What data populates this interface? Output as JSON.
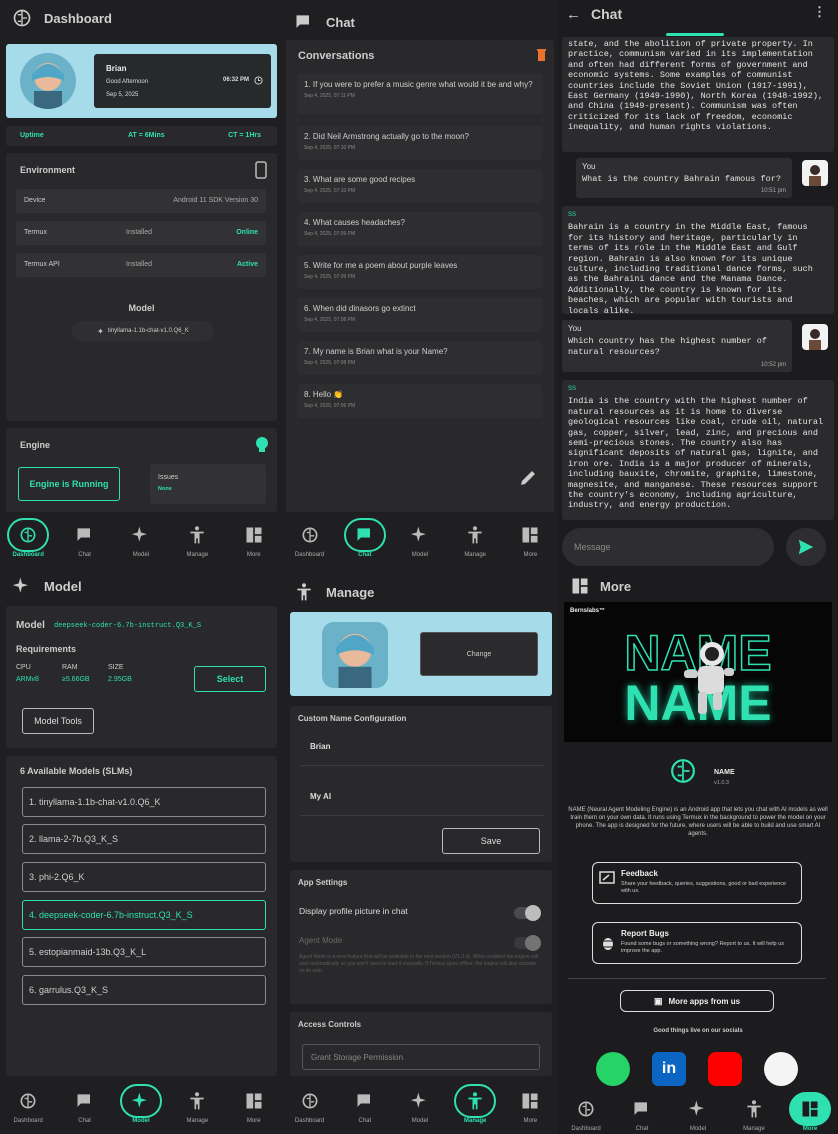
{
  "dashboard": {
    "title": "Dashboard",
    "user": "Brian",
    "greeting": "Good Afternoon",
    "time": "06:32 PM",
    "date": "Sep 5, 2025",
    "uptime_label": "Uptime",
    "at": "AT = 6Mins",
    "ct": "CT = 1Hrs",
    "env_title": "Environment",
    "rows": [
      {
        "label": "Device",
        "value": "Android 11 SDK Version 30",
        "status": ""
      },
      {
        "label": "Termux",
        "value": "Installed",
        "status": "Online"
      },
      {
        "label": "Termux API",
        "value": "Installed",
        "status": "Active"
      }
    ],
    "model_title": "Model",
    "model_name": "tinyllama-1.1b-chat-v1.0.Q6_K",
    "engine_title": "Engine",
    "engine_btn": "Engine is Running",
    "issues_label": "Issues",
    "issues_value": "None"
  },
  "nav": {
    "dashboard": "Dashboard",
    "chat": "Chat",
    "model": "Model",
    "manage": "Manage",
    "more": "More"
  },
  "chatlist": {
    "title": "Chat",
    "section": "Conversations",
    "items": [
      {
        "q": "1. If you were to prefer a music genre what would it be and why?",
        "d": "Sep 4, 2025, 07:11 PM"
      },
      {
        "q": "2. Did Neil Armstrong actually go to the moon?",
        "d": "Sep 4, 2025, 07:10 PM"
      },
      {
        "q": "3. What are some good recipes",
        "d": "Sep 4, 2025, 07:10 PM"
      },
      {
        "q": "4. What causes headaches?",
        "d": "Sep 4, 2025, 07:09 PM"
      },
      {
        "q": "5. Write for me a poem about purple leaves",
        "d": "Sep 4, 2025, 07:09 PM"
      },
      {
        "q": "6. When did dinasors go extinct",
        "d": "Sep 4, 2025, 07:08 PM"
      },
      {
        "q": "7. My name is Brian what is your Name?",
        "d": "Sep 4, 2025, 07:08 PM"
      },
      {
        "q": "8. Hello 👏",
        "d": "Sep 4, 2025, 07:06 PM"
      }
    ]
  },
  "chat": {
    "title": "Chat",
    "ai1": "state, and the abolition of private property. In practice, communism varied in its implementation and often had different forms of government and economic systems. Some examples of communist countries include the Soviet Union (1917-1991), East Germany (1949-1990), North Korea (1948-1992), and China (1949-present). Communism was often criticized for its lack of freedom, economic inequality, and human rights violations.",
    "u1_who": "You",
    "u1": "What is the country Bahrain famous for?",
    "u1_time": "10:51 pm",
    "ai_who": "SS",
    "ai2": "Bahrain is a country in the Middle East, famous for its history and heritage, particularly in terms of its role in the Middle East and Gulf region. Bahrain is also known for its unique culture, including traditional dance forms, such as the Bahraini dance and the Manama Dance. Additionally, the country is known for its beaches, which are popular with tourists and locals alike.",
    "u2_who": "You",
    "u2": "Which country has the highest number of natural resources?",
    "u2_time": "10:52 pm",
    "ai3": "India is the country with the highest number of natural resources as it is home to diverse geological resources like coal, crude oil, natural gas, copper, silver, lead, zinc, and precious and semi-precious stones. The country also has significant deposits of natural gas, lignite, and iron ore. India is a major producer of minerals, including bauxite, chromite, graphite, limestone, magnesite, and manganese. These resources support the country's economy, including agriculture, industry, and energy production.",
    "placeholder": "Message"
  },
  "model": {
    "title": "Model",
    "model_label": "Model",
    "model_name": "deepseek-coder-6.7b-instruct.Q3_K_S",
    "req": "Requirements",
    "cpu_l": "CPU",
    "cpu": "ARMv8",
    "ram_l": "RAM",
    "ram": "≥5.66GB",
    "size_l": "SIZE",
    "size": "2.95GB",
    "select": "Select",
    "tools": "Model Tools",
    "avail": "6 Available Models (SLMs)",
    "items": [
      "1. tinyllama-1.1b-chat-v1.0.Q6_K",
      "2. llama-2-7b.Q3_K_S",
      "3. phi-2.Q6_K",
      "4. deepseek-coder-6.7b-instruct.Q3_K_S",
      "5. estopianmaid-13b.Q3_K_L",
      "6. garrulus.Q3_K_S"
    ]
  },
  "manage": {
    "title": "Manage",
    "change": "Change",
    "custom": "Custom Name Configuration",
    "name1": "Brian",
    "name2": "My AI",
    "save": "Save",
    "app_settings": "App Settings",
    "display_pic": "Display profile picture in chat",
    "agent_mode": "Agent Mode",
    "agent_desc": "Agent Mode is a new feature that will be available in the next version (V1.0.4). When enabled the engine will start automatically so you won't need to start it manually. If Termux goes offline, the engine will also activate on its own.",
    "access": "Access Controls",
    "grant": "Grant Storage Permission"
  },
  "more": {
    "title": "More",
    "brand": "Bernslabs™",
    "banner1": "NAME",
    "banner2": "NAME",
    "app": "NAME",
    "ver": "v1.0.3",
    "desc": "NAME (Neural Agent Modeling Engine) is an Android app that lets you chat with AI models as well train them on your own data. It runs using Termux in the background to power the model on your phone. The app is designed for the future, where users will be able to build and use smart AI agents.",
    "fb_title": "Feedback",
    "fb_desc": "Share your feedback, queries, suggestions, good or bad experience with us.",
    "rb_title": "Report Bugs",
    "rb_desc": "Found some bugs or something wrong? Report to us. It will help us improve the app.",
    "more_apps": "More apps from us",
    "socials": "Good things live on our socials"
  },
  "colors": {
    "accent": "#2fe0b0",
    "panel": "#1f1f21",
    "card": "#29292b",
    "hero": "#a6dce9"
  }
}
